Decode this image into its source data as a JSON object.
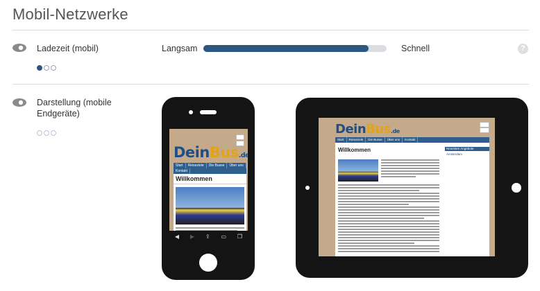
{
  "page": {
    "title": "Mobil-Netzwerke"
  },
  "load_time": {
    "label": "Ladezeit (mobil)",
    "slow_label": "Langsam",
    "fast_label": "Schnell",
    "level_fraction": 0.9,
    "rating": [
      true,
      false,
      false
    ],
    "help_icon": "question-icon",
    "help_text": "?"
  },
  "display": {
    "label": "Darstellung (mobile Endgeräte)",
    "rating": [
      false,
      false,
      false
    ]
  },
  "preview": {
    "logo_text_a": "Dein",
    "logo_text_b": "Bus",
    "logo_suffix": ".de",
    "nav": [
      "Start",
      "Reiseziele",
      "Die Busse",
      "Über uns",
      "Kontakt"
    ],
    "heading": "Willkommen",
    "sidebar_title": "Neuesten Angebote",
    "sidebar_link": "Amsterdam",
    "body_text": "Lorem ipsum dolor sit amet, consetetur sadipscing elitr, sed diam nonumy eirmod tempor invidunt ut labore et dolore magna aliquyam erat"
  },
  "colors": {
    "accent": "#2d5680",
    "track": "#dcdde0",
    "device": "#141414",
    "site_bg": "#c4a98b"
  }
}
